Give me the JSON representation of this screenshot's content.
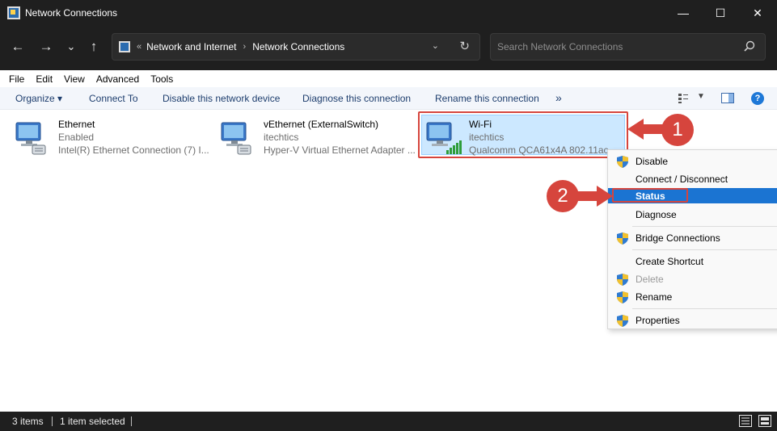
{
  "window": {
    "title": "Network Connections",
    "minimize": "—",
    "maximize": "☐",
    "close": "✕"
  },
  "nav": {
    "back": "←",
    "forward": "→",
    "recent": "⌄",
    "up": "↑"
  },
  "address": {
    "overflow": "«",
    "crumbs": [
      "Network and Internet",
      "Network Connections"
    ],
    "separator": "›"
  },
  "search": {
    "placeholder": "Search Network Connections"
  },
  "menubar": [
    "File",
    "Edit",
    "View",
    "Advanced",
    "Tools"
  ],
  "commandbar": {
    "organize": "Organize ▾",
    "connect_to": "Connect To",
    "disable": "Disable this network device",
    "diagnose": "Diagnose this connection",
    "rename": "Rename this connection",
    "more": "»"
  },
  "items": [
    {
      "name": "Ethernet",
      "status": "Enabled",
      "device": "Intel(R) Ethernet Connection (7) I..."
    },
    {
      "name": "vEthernet (ExternalSwitch)",
      "status": "itechtics",
      "device": "Hyper-V Virtual Ethernet Adapter ..."
    },
    {
      "name": "Wi-Fi",
      "status": "itechtics",
      "device": "Qualcomm QCA61x4A 802.11ac"
    }
  ],
  "context_menu": [
    {
      "label": "Disable",
      "shield": true,
      "disabled": false
    },
    {
      "label": "Connect / Disconnect",
      "shield": false,
      "disabled": false
    },
    {
      "label": "Status",
      "shield": false,
      "disabled": false,
      "highlighted": true
    },
    {
      "label": "Diagnose",
      "shield": false,
      "disabled": false
    },
    {
      "label": "Bridge Connections",
      "shield": true,
      "disabled": false
    },
    {
      "label": "Create Shortcut",
      "shield": false,
      "disabled": false
    },
    {
      "label": "Delete",
      "shield": true,
      "disabled": true
    },
    {
      "label": "Rename",
      "shield": true,
      "disabled": false
    },
    {
      "label": "Properties",
      "shield": true,
      "disabled": false
    }
  ],
  "callouts": [
    "1",
    "2"
  ],
  "statusbar": {
    "items_count": "3 items",
    "selected": "1 item selected"
  },
  "colors": {
    "chrome_dark": "#1f1f1f",
    "selection": "#cce8ff",
    "highlight": "#1b74d2",
    "callout_red": "#d6453d"
  }
}
